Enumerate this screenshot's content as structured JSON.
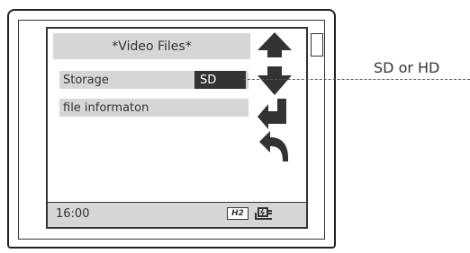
{
  "screen": {
    "title": "*Video Files*",
    "menu": [
      {
        "label": "Storage",
        "value": "SD"
      },
      {
        "label": "file informaton"
      }
    ],
    "status": {
      "time": "16:00",
      "badge": "H2",
      "icons": [
        "hd-badge-icon",
        "power-plug-icon"
      ]
    }
  },
  "nav": {
    "buttons": [
      "arrow-up-icon",
      "arrow-down-icon",
      "enter-icon",
      "back-icon"
    ]
  },
  "callout": {
    "label": "SD or HD"
  }
}
